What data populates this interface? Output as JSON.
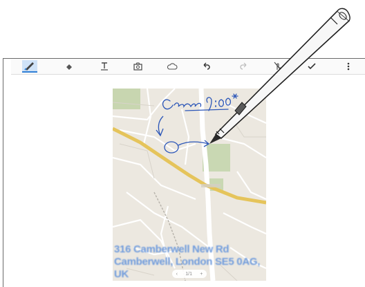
{
  "toolbar": {
    "items": [
      {
        "name": "pen-tool",
        "icon": "pen-icon",
        "active": true
      },
      {
        "name": "eraser-tool",
        "icon": "eraser-icon"
      },
      {
        "name": "text-tool",
        "icon": "text-icon"
      },
      {
        "name": "image-tool",
        "icon": "camera-icon"
      },
      {
        "name": "shape-tool",
        "icon": "cloud-icon"
      },
      {
        "name": "undo-tool",
        "icon": "undo-icon"
      },
      {
        "name": "redo-tool",
        "icon": "redo-icon"
      },
      {
        "name": "touch-mode-tool",
        "icon": "no-touch-icon"
      },
      {
        "name": "done-tool",
        "icon": "check-icon"
      },
      {
        "name": "more-options-tool",
        "icon": "more-icon"
      }
    ],
    "accent_color": "#2f7fd6"
  },
  "map": {
    "address_line1": "316 Camberwell New Rd",
    "address_line2": "Camberwell, London SE5 0AG,",
    "address_line3": "UK"
  },
  "pager": {
    "prev": "‹",
    "page": "1/1",
    "add": "+"
  },
  "handwriting": {
    "note": "Came 9:00*",
    "ink_color": "#2b56b8"
  }
}
